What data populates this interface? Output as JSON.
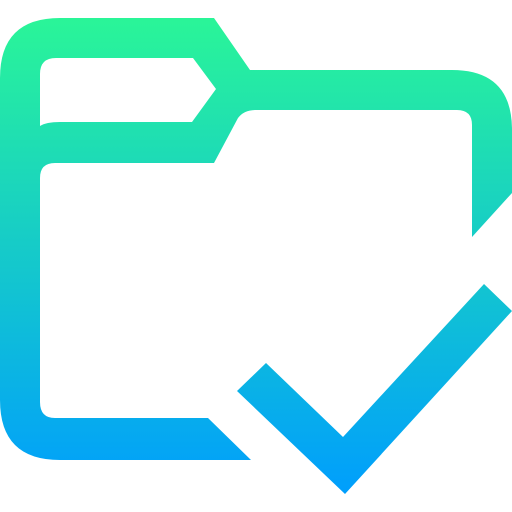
{
  "icon": {
    "name": "folder-check-icon",
    "gradient": {
      "top_color": "#2af598",
      "bottom_color": "#009efd"
    }
  }
}
